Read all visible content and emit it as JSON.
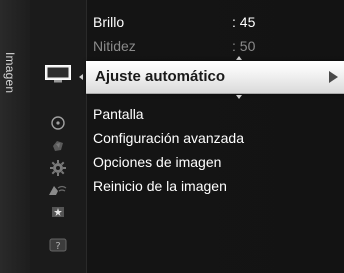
{
  "menu": {
    "category_label": "Imagen",
    "scroll_up_icon": "triangle-up",
    "scroll_down_icon": "triangle-down",
    "items_above": [
      {
        "label": "Brillo",
        "value": ": 45",
        "state": "normal"
      },
      {
        "label": "Nitidez",
        "value": ": 50",
        "state": "dimmed"
      }
    ],
    "selected": {
      "label": "Ajuste automático",
      "icon": "triangle-right"
    },
    "items_below": [
      {
        "label": "Pantalla"
      },
      {
        "label": "Configuración avanzada"
      },
      {
        "label": "Opciones de imagen"
      },
      {
        "label": "Reinicio de la imagen"
      }
    ]
  },
  "sidebar_icons": [
    {
      "name": "picture-icon",
      "active": true
    },
    {
      "name": "sound-icon",
      "active": false
    },
    {
      "name": "channel-icon",
      "active": false
    },
    {
      "name": "setup-icon",
      "active": false
    },
    {
      "name": "input-icon",
      "active": false
    },
    {
      "name": "application-icon",
      "active": false
    },
    {
      "name": "support-icon",
      "active": false
    }
  ],
  "colors": {
    "highlight": "#f0f0f0",
    "text": "#ffffff",
    "dimmed_text": "#8a8a8a",
    "background": "#141414"
  }
}
